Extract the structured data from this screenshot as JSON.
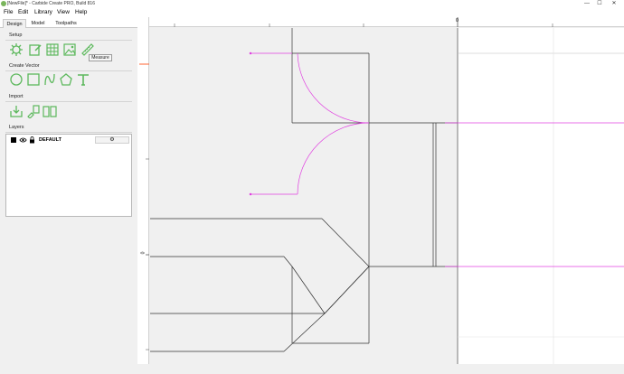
{
  "window": {
    "title": "[NewFile]* - Carbide Create PRO, Build 816",
    "minimize_glyph": "—",
    "maximize_glyph": "☐",
    "close_glyph": "✕"
  },
  "menu": {
    "items": [
      "File",
      "Edit",
      "Library",
      "View",
      "Help"
    ]
  },
  "tabs": [
    "Design",
    "Model",
    "Toolpaths"
  ],
  "active_tab": "Design",
  "sidebar": {
    "setup_label": "Setup",
    "create_vector_label": "Create Vector",
    "import_label": "Import",
    "layers_label": "Layers",
    "tooltip": "Measure"
  },
  "layers": [
    {
      "name": "DEFAULT",
      "gear_glyph": "⚙"
    }
  ],
  "ruler": {
    "h_zero": "0",
    "v_zero": "0"
  },
  "colors": {
    "accent_green": "#5cb85c",
    "vector_magenta": "#e040e0",
    "stock_fill": "#f0f0f0",
    "line": "#333333",
    "ruler_marker": "#ff6633"
  },
  "icons": {
    "setup": [
      "gear-icon",
      "edit-document-icon",
      "grid-icon",
      "image-icon",
      "measure-ruler-icon"
    ],
    "create_vector": [
      "circle-icon",
      "rectangle-icon",
      "curve-icon",
      "polygon-icon",
      "text-icon"
    ],
    "import": [
      "import-arrow-icon",
      "import-shapes-icon",
      "library-book-icon"
    ]
  }
}
